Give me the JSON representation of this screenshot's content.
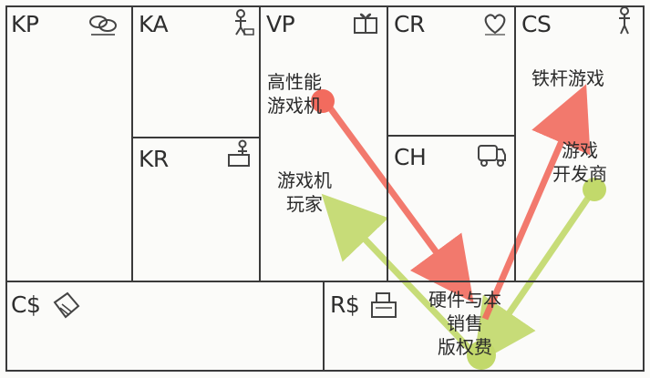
{
  "canvas": {
    "blocks": [
      {
        "key": "kp",
        "label": "KP",
        "icon": "chain-links-icon"
      },
      {
        "key": "ka",
        "label": "KA",
        "icon": "worker-icon"
      },
      {
        "key": "vp",
        "label": "VP",
        "icon": "gift-box-icon"
      },
      {
        "key": "cr",
        "label": "CR",
        "icon": "heart-icon"
      },
      {
        "key": "cs",
        "label": "CS",
        "icon": "person-icon"
      },
      {
        "key": "kr",
        "label": "KR",
        "icon": "worker-box-icon"
      },
      {
        "key": "ch",
        "label": "CH",
        "icon": "truck-icon"
      },
      {
        "key": "cost",
        "label": "C$",
        "icon": "price-tag-icon"
      },
      {
        "key": "rev",
        "label": "R$",
        "icon": "cash-register-icon"
      }
    ]
  },
  "notes": {
    "vp_product": [
      "高性能",
      "游戏机"
    ],
    "vp_player": [
      "游戏机",
      "玩家"
    ],
    "cs_fans": [
      "铁杆游戏"
    ],
    "cs_dev": [
      "游戏",
      "开发商"
    ],
    "rev_streams": [
      "硬件与本",
      "销售",
      "版权费"
    ]
  },
  "colors": {
    "red_arrow": "#f26b5e",
    "green_arrow": "#c2d96b",
    "grid_line": "#3a3a3a"
  },
  "arrows": [
    {
      "name": "product-to-revenue-arrow",
      "color": "red",
      "from": "vp_product",
      "to": "rev_streams"
    },
    {
      "name": "revenue-to-fans-arrow",
      "color": "red",
      "from": "rev_streams",
      "to": "cs_fans"
    },
    {
      "name": "developer-to-revenue-arrow",
      "color": "green",
      "from": "cs_dev",
      "to": "rev_streams"
    },
    {
      "name": "revenue-to-player-arrow",
      "color": "green",
      "from": "rev_streams",
      "to": "vp_player"
    }
  ]
}
